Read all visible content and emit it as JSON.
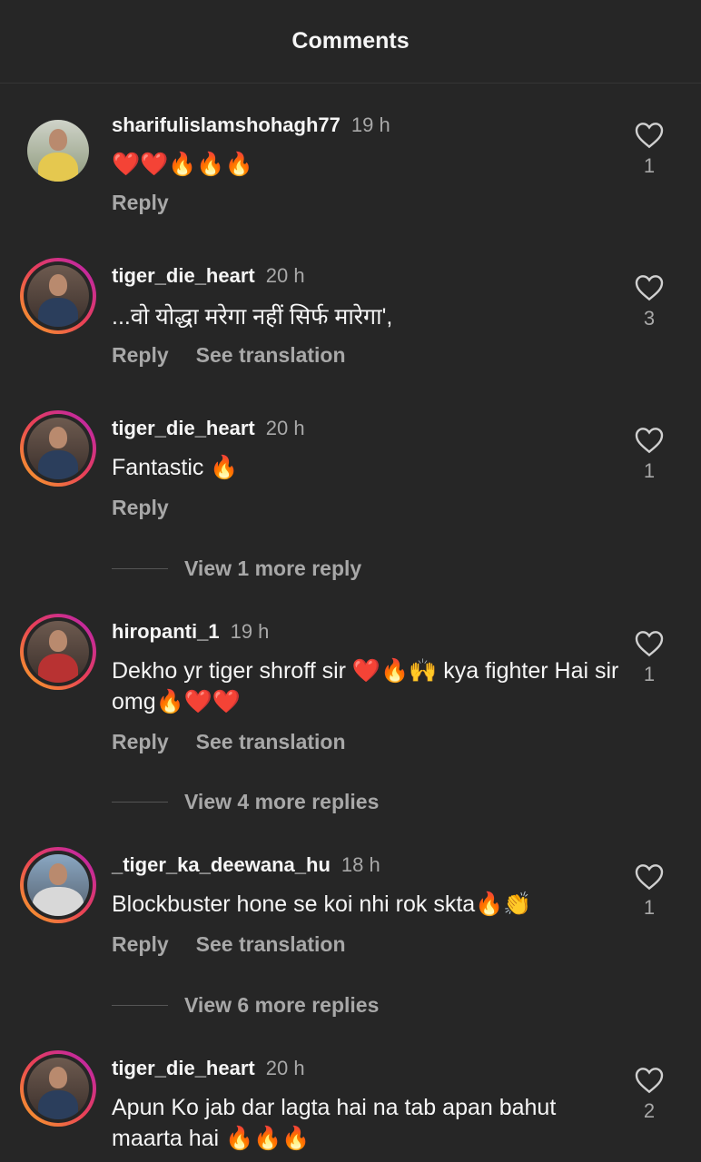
{
  "header": {
    "title": "Comments"
  },
  "labels": {
    "reply": "Reply",
    "see_translation": "See translation"
  },
  "comments": [
    {
      "username": "sharifulislamshohagh77",
      "time": "19 h",
      "text": "❤️❤️🔥🔥🔥",
      "likes": "1",
      "has_translation": false,
      "story_ring": false
    },
    {
      "username": "tiger_die_heart",
      "time": "20 h",
      "text": "...वो योद्धा मरेगा नहीं सिर्फ मारेगा',",
      "likes": "3",
      "has_translation": true,
      "story_ring": true
    },
    {
      "username": "tiger_die_heart",
      "time": "20 h",
      "text": "Fantastic 🔥",
      "likes": "1",
      "has_translation": false,
      "story_ring": true,
      "more_replies": "View 1 more reply"
    },
    {
      "username": "hiropanti_1",
      "time": "19 h",
      "text": "Dekho yr tiger shroff sir ❤️🔥🙌 kya fighter Hai sir omg🔥❤️❤️",
      "likes": "1",
      "has_translation": true,
      "story_ring": true,
      "more_replies": "View 4 more replies"
    },
    {
      "username": "_tiger_ka_deewana_hu",
      "time": "18 h",
      "text": "Blockbuster hone se koi nhi rok skta🔥👏",
      "likes": "1",
      "has_translation": true,
      "story_ring": true,
      "more_replies": "View 6 more replies"
    },
    {
      "username": "tiger_die_heart",
      "time": "20 h",
      "text": "Apun Ko jab dar lagta hai na tab apan bahut maarta hai 🔥🔥🔥",
      "likes": "2",
      "has_translation": false,
      "story_ring": true
    }
  ]
}
